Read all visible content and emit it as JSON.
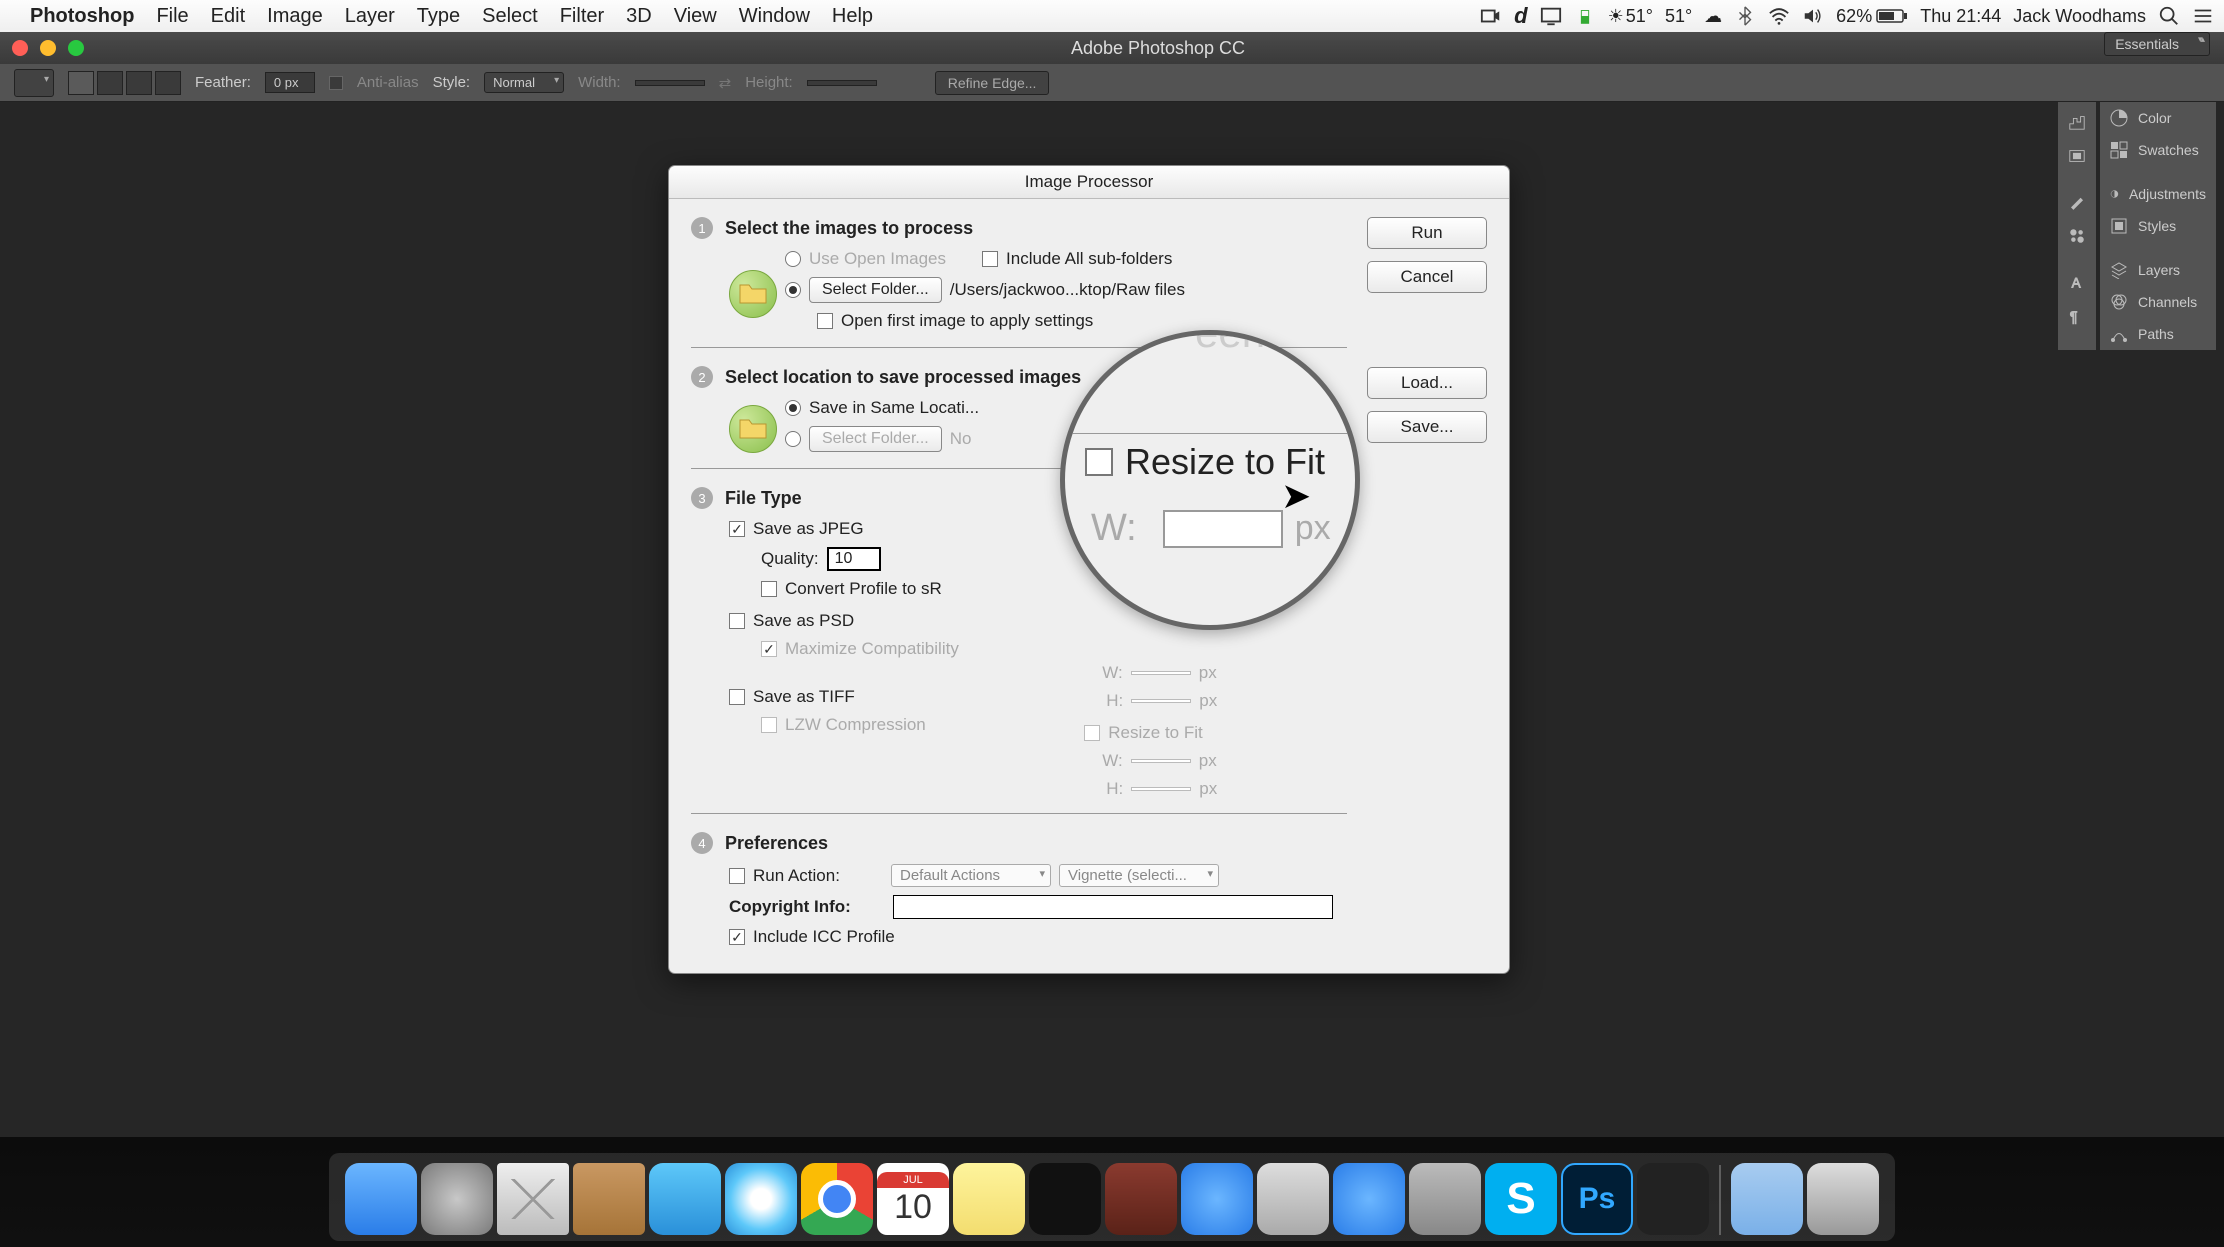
{
  "menubar": {
    "app": "Photoshop",
    "items": [
      "File",
      "Edit",
      "Image",
      "Layer",
      "Type",
      "Select",
      "Filter",
      "3D",
      "View",
      "Window",
      "Help"
    ],
    "status": {
      "temp1": "51°",
      "temp2": "51°",
      "battery": "62%",
      "clock": "Thu 21:44",
      "user": "Jack Woodhams"
    }
  },
  "window": {
    "title": "Adobe Photoshop CC"
  },
  "options_bar": {
    "feather_label": "Feather:",
    "feather_value": "0 px",
    "antialias": "Anti-alias",
    "style_label": "Style:",
    "style_value": "Normal",
    "width_label": "Width:",
    "height_label": "Height:",
    "refine": "Refine Edge...",
    "workspace": "Essentials"
  },
  "right_panels": [
    "Color",
    "Swatches",
    "Adjustments",
    "Styles",
    "Layers",
    "Channels",
    "Paths"
  ],
  "dialog": {
    "title": "Image Processor",
    "buttons": {
      "run": "Run",
      "cancel": "Cancel",
      "load": "Load...",
      "save": "Save..."
    },
    "s1": {
      "num": "1",
      "title": "Select the images to process",
      "use_open": "Use Open Images",
      "include_sub": "Include All sub-folders",
      "select_folder": "Select Folder...",
      "path": "/Users/jackwoo...ktop/Raw files",
      "open_first": "Open first image to apply settings"
    },
    "s2": {
      "num": "2",
      "title": "Select location to save processed images",
      "same_location": "Save in Same Locati...",
      "select_folder": "Select Folder...",
      "no_folder": "No"
    },
    "s3": {
      "num": "3",
      "title": "File Type",
      "jpeg": "Save as JPEG",
      "quality_label": "Quality:",
      "quality_value": "10",
      "convert_profile": "Convert Profile to sR",
      "psd": "Save as PSD",
      "max_compat": "Maximize Compatibility",
      "tiff": "Save as TIFF",
      "lzw": "LZW Compression",
      "resize_fit": "Resize to Fit",
      "w": "W:",
      "h": "H:",
      "px": "px"
    },
    "s4": {
      "num": "4",
      "title": "Preferences",
      "run_action": "Run Action:",
      "action_set": "Default Actions",
      "action": "Vignette (selecti...",
      "copyright": "Copyright Info:",
      "icc": "Include ICC Profile"
    }
  },
  "magnifier": {
    "resize": "Resize to Fit",
    "w": "W:",
    "px": "px",
    "ghost": "een se"
  },
  "calendar": {
    "month": "JUL",
    "day": "10"
  }
}
